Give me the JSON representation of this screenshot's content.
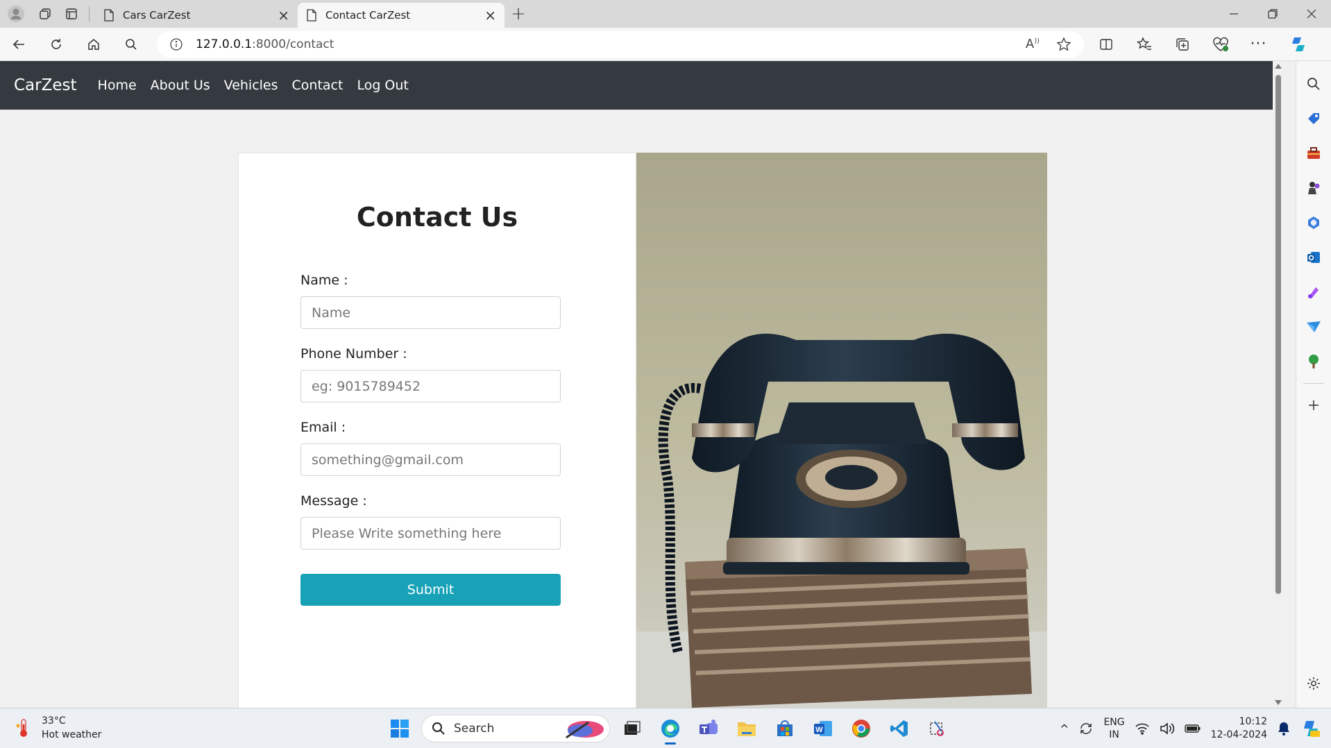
{
  "browser": {
    "tabs": [
      {
        "title": "Cars CarZest",
        "active": false
      },
      {
        "title": "Contact CarZest",
        "active": true
      }
    ],
    "address": {
      "host": "127.0.0.1",
      "rest": ":8000/contact"
    },
    "window_controls": [
      "minimize",
      "restore",
      "close"
    ]
  },
  "site": {
    "brand": "CarZest",
    "nav": [
      "Home",
      "About Us",
      "Vehicles",
      "Contact",
      "Log Out"
    ]
  },
  "contact": {
    "title": "Contact Us",
    "fields": [
      {
        "label": "Name :",
        "placeholder": "Name"
      },
      {
        "label": "Phone Number :",
        "placeholder": "eg: 9015789452"
      },
      {
        "label": "Email :",
        "placeholder": "something@gmail.com"
      },
      {
        "label": "Message :",
        "placeholder": "Please Write something here"
      }
    ],
    "submit_label": "Submit",
    "image_subject": "vintage rotary telephone on a stack of old books"
  },
  "taskbar": {
    "weather": {
      "temp": "33°C",
      "desc": "Hot weather"
    },
    "search_label": "Search",
    "lang": {
      "line1": "ENG",
      "line2": "IN"
    },
    "clock": {
      "time": "10:12",
      "date": "12-04-2024"
    }
  },
  "colors": {
    "navbar": "#343a40",
    "submit": "#17a2b8",
    "page_bg": "#f0f0f0"
  }
}
